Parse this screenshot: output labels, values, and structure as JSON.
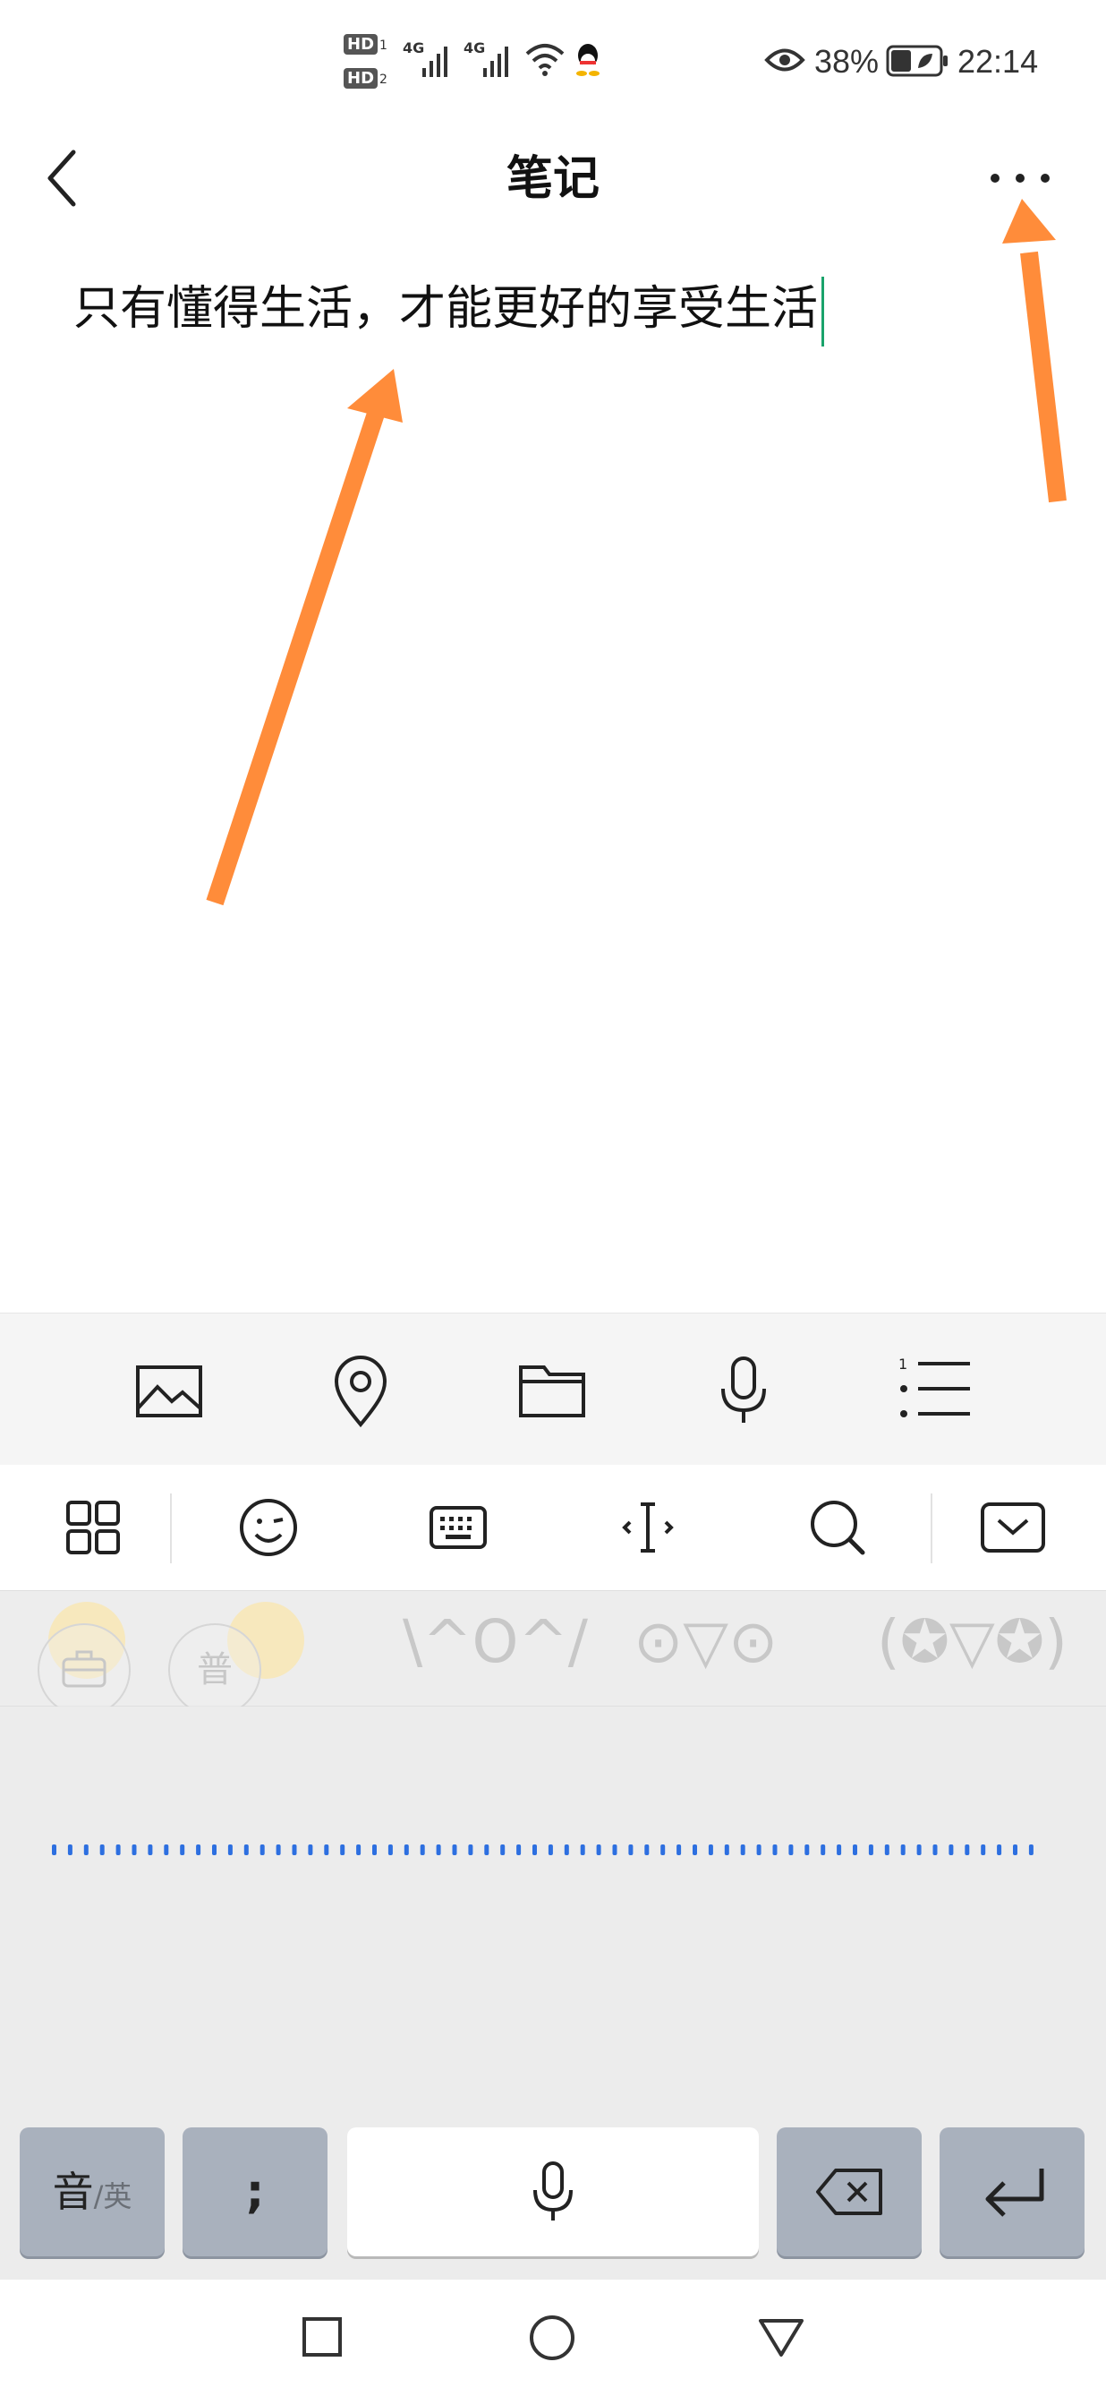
{
  "status_bar": {
    "hd1": "HD",
    "hd1_sub": "1",
    "hd2": "HD",
    "hd2_sub": "2",
    "net1": "4G",
    "net2": "4G",
    "battery_percent": "38%",
    "time": "22:14",
    "icons": [
      "hd-icon",
      "signal-icon",
      "wifi-icon",
      "qq-icon",
      "eye-icon",
      "battery-icon"
    ]
  },
  "header": {
    "title": "笔记",
    "back_icon": "back-icon",
    "more_icon": "more-icon"
  },
  "note": {
    "text": "只有懂得生活，才能更好的享受生活"
  },
  "attach_toolbar": {
    "icons": [
      "image-icon",
      "location-icon",
      "folder-icon",
      "microphone-icon",
      "numbered-list-icon"
    ]
  },
  "keyboard_toolbar": {
    "icons": [
      "grid-icon",
      "emoji-icon",
      "keyboard-icon",
      "cursor-icon",
      "search-icon",
      "hide-keyboard-icon"
    ]
  },
  "candidates": {
    "kaomoji": [
      "\\^O^/",
      "⊙▽⊙",
      "(✪▽✪)"
    ],
    "float_buttons": [
      "",
      "普"
    ]
  },
  "keyboard_keys": {
    "lang_main": "音",
    "lang_sub": "/英",
    "punct": ";",
    "mic_icon": "microphone-icon",
    "delete_icon": "backspace-icon",
    "enter_icon": "enter-icon"
  },
  "colors": {
    "accent_arrow": "#ff8c3a",
    "caret": "#1aa36b",
    "voice_dots": "#2d6fe0",
    "key_gray": "#a9b1bd"
  },
  "nav_bar": {
    "icons": [
      "recent-apps-icon",
      "home-icon",
      "back-nav-icon"
    ]
  }
}
